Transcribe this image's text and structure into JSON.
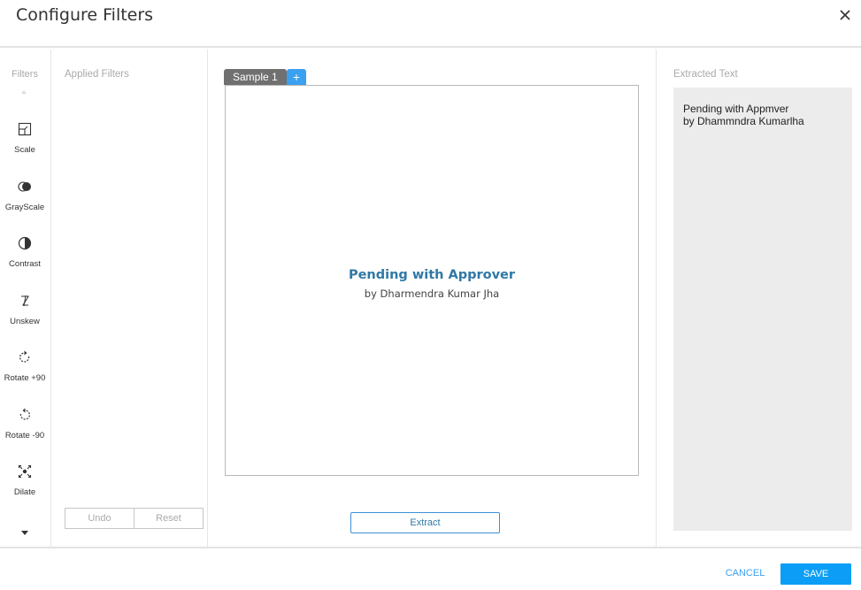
{
  "dialog": {
    "title": "Configure Filters",
    "close_icon": "close-icon"
  },
  "filters": {
    "label": "Filters",
    "items": [
      {
        "label": "Scale",
        "icon": "scale-icon"
      },
      {
        "label": "GrayScale",
        "icon": "grayscale-icon"
      },
      {
        "label": "Contrast",
        "icon": "contrast-icon"
      },
      {
        "label": "Unskew",
        "icon": "unskew-icon"
      },
      {
        "label": "Rotate +90",
        "icon": "rotate-cw-icon"
      },
      {
        "label": "Rotate -90",
        "icon": "rotate-ccw-icon"
      },
      {
        "label": "Dilate",
        "icon": "dilate-icon"
      }
    ]
  },
  "applied": {
    "label": "Applied Filters",
    "undo_label": "Undo",
    "reset_label": "Reset"
  },
  "preview": {
    "tab_label": "Sample 1",
    "add_tab_label": "+",
    "sample_title": "Pending with Approver",
    "sample_subtitle": "by Dharmendra Kumar Jha",
    "extract_label": "Extract"
  },
  "extracted": {
    "label": "Extracted Text",
    "line1": "Pending with Appmver",
    "line2": "by Dhammndra Kumarlha"
  },
  "footer": {
    "cancel_label": "CANCEL",
    "save_label": "SAVE"
  },
  "colors": {
    "accent": "#0c9ef6",
    "tab_active": "#707070",
    "sample_title": "#2f78a6",
    "extracted_bg": "#ececec"
  }
}
